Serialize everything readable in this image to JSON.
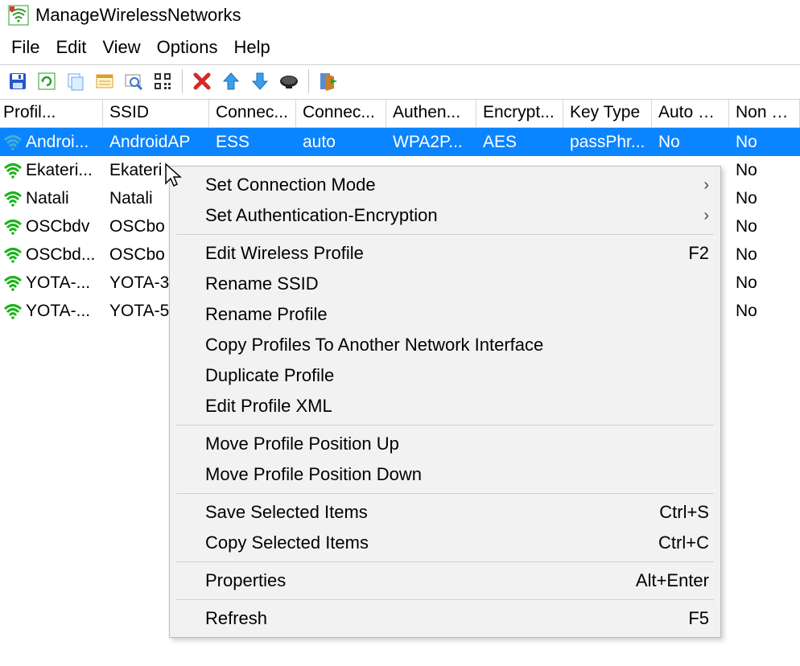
{
  "app": {
    "title": "ManageWirelessNetworks"
  },
  "menu": {
    "file": "File",
    "edit": "Edit",
    "view": "View",
    "options": "Options",
    "help": "Help"
  },
  "columns": {
    "profile": "Profil...",
    "ssid": "SSID",
    "connection_type": "Connec...",
    "connection_mode": "Connec...",
    "authentication": "Authen...",
    "encryption": "Encrypt...",
    "key_type": "Key Type",
    "auto_switch": "Auto S...",
    "non_broadcast": "Non B..."
  },
  "rows": [
    {
      "profile": "Androi...",
      "ssid": "AndroidAP",
      "conn_type": "ESS",
      "conn_mode": "auto",
      "auth": "WPA2P...",
      "enc": "AES",
      "key": "passPhr...",
      "auto": "No",
      "nonb": "No",
      "selected": true,
      "color": "#3eb0d1"
    },
    {
      "profile": "Ekateri...",
      "ssid": "Ekateri",
      "nonb": "No",
      "color": "#1bb31b"
    },
    {
      "profile": "Natali",
      "ssid": "Natali",
      "nonb": "No",
      "color": "#1bb31b"
    },
    {
      "profile": "OSCbdv",
      "ssid": "OSCbo",
      "nonb": "No",
      "color": "#1bb31b"
    },
    {
      "profile": "OSCbd...",
      "ssid": "OSCbo",
      "nonb": "No",
      "color": "#1bb31b"
    },
    {
      "profile": "YOTA-...",
      "ssid": "YOTA-3",
      "nonb": "No",
      "color": "#1bb31b"
    },
    {
      "profile": "YOTA-...",
      "ssid": "YOTA-5",
      "nonb": "No",
      "color": "#1bb31b"
    }
  ],
  "context_menu": {
    "set_conn_mode": "Set Connection Mode",
    "set_auth_enc": "Set Authentication-Encryption",
    "edit_profile": "Edit Wireless Profile",
    "edit_profile_key": "F2",
    "rename_ssid": "Rename SSID",
    "rename_profile": "Rename Profile",
    "copy_to_iface": "Copy Profiles To Another Network Interface",
    "duplicate": "Duplicate Profile",
    "edit_xml": "Edit Profile XML",
    "move_up": "Move Profile Position Up",
    "move_down": "Move Profile Position Down",
    "save_selected": "Save Selected Items",
    "save_selected_key": "Ctrl+S",
    "copy_selected": "Copy Selected Items",
    "copy_selected_key": "Ctrl+C",
    "properties": "Properties",
    "properties_key": "Alt+Enter",
    "refresh": "Refresh",
    "refresh_key": "F5"
  }
}
